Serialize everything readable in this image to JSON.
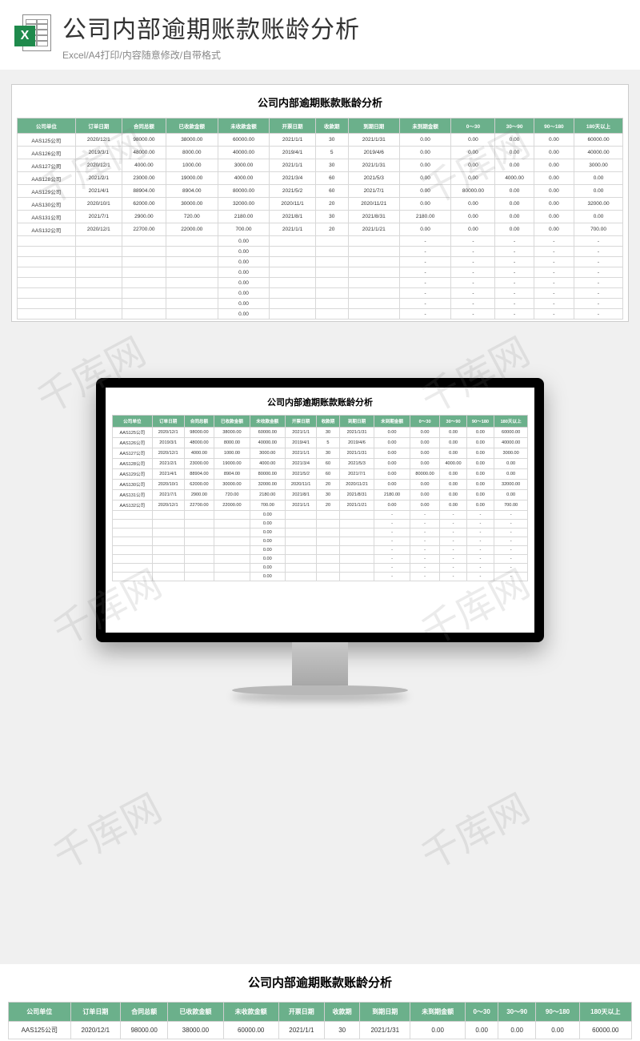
{
  "page_title": "公司内部逾期账款账龄分析",
  "subtitle": "Excel/A4打印/内容随意修改/自带格式",
  "excel_icon_letter": "X",
  "table_title": "公司内部逾期账款账龄分析",
  "watermark_text": "千库网",
  "columns": [
    "公司单位",
    "订单日期",
    "合同总额",
    "已收款金额",
    "未收款金额",
    "开票日期",
    "收款期",
    "到期日期",
    "未到期金额",
    "0～30",
    "30～90",
    "90～180",
    "180天以上"
  ],
  "rows": [
    [
      "AAS125公司",
      "2020/12/1",
      "98000.00",
      "38000.00",
      "60000.00",
      "2021/1/1",
      "30",
      "2021/1/31",
      "0.00",
      "0.00",
      "0.00",
      "0.00",
      "60000.00"
    ],
    [
      "AAS126公司",
      "2019/3/1",
      "48000.00",
      "8000.00",
      "40000.00",
      "2019/4/1",
      "5",
      "2019/4/6",
      "0.00",
      "0.00",
      "0.00",
      "0.00",
      "40000.00"
    ],
    [
      "AAS127公司",
      "2020/12/1",
      "4000.00",
      "1000.00",
      "3000.00",
      "2021/1/1",
      "30",
      "2021/1/31",
      "0.00",
      "0.00",
      "0.00",
      "0.00",
      "3000.00"
    ],
    [
      "AAS128公司",
      "2021/2/1",
      "23000.00",
      "19000.00",
      "4000.00",
      "2021/3/4",
      "60",
      "2021/5/3",
      "0.00",
      "0.00",
      "4000.00",
      "0.00",
      "0.00"
    ],
    [
      "AAS129公司",
      "2021/4/1",
      "88904.00",
      "8904.00",
      "80000.00",
      "2021/5/2",
      "60",
      "2021/7/1",
      "0.00",
      "80000.00",
      "0.00",
      "0.00",
      "0.00"
    ],
    [
      "AAS130公司",
      "2020/10/1",
      "62000.00",
      "30000.00",
      "32000.00",
      "2020/11/1",
      "20",
      "2020/11/21",
      "0.00",
      "0.00",
      "0.00",
      "0.00",
      "32000.00"
    ],
    [
      "AAS131公司",
      "2021/7/1",
      "2900.00",
      "720.00",
      "2180.00",
      "2021/8/1",
      "30",
      "2021/8/31",
      "2180.00",
      "0.00",
      "0.00",
      "0.00",
      "0.00"
    ],
    [
      "AAS132公司",
      "2020/12/1",
      "22700.00",
      "22000.00",
      "700.00",
      "2021/1/1",
      "20",
      "2021/1/21",
      "0.00",
      "0.00",
      "0.00",
      "0.00",
      "700.00"
    ]
  ],
  "empty_rows_count": 8,
  "empty_uncollected": "0.00",
  "empty_placeholder": "-",
  "bottom_row": [
    "AAS125公司",
    "2020/12/1",
    "98000.00",
    "38000.00",
    "60000.00",
    "2021/1/1",
    "30",
    "2021/1/31",
    "0.00",
    "0.00",
    "0.00",
    "0.00",
    "60000.00"
  ],
  "colors": {
    "header_bg": "#6bb08b"
  }
}
